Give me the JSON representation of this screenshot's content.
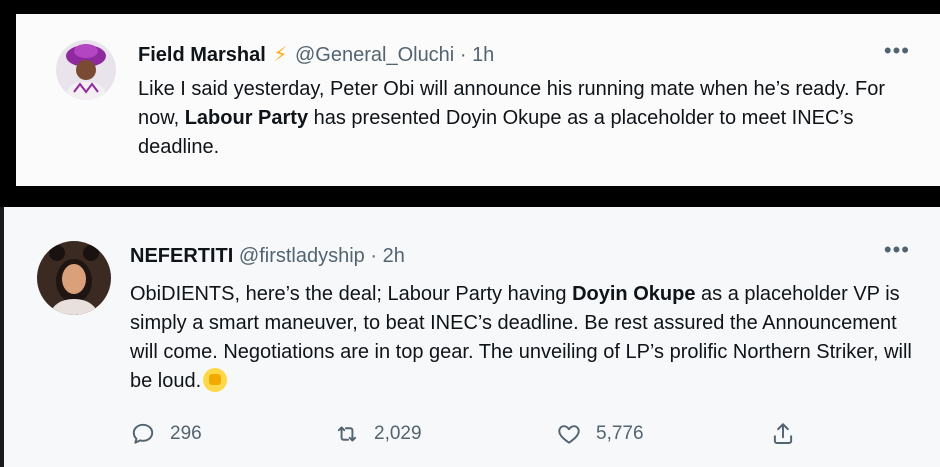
{
  "tweets": [
    {
      "display_name": "Field Marshal",
      "handle": "@General_Oluchi",
      "separator": "·",
      "time": "1h",
      "more_label": "•••",
      "text_parts": [
        {
          "t": "Like I said yesterday, Peter Obi will announce his running mate when he’s ready. For now, ",
          "bold": false
        },
        {
          "t": "Labour Party",
          "bold": true
        },
        {
          "t": " has presented Doyin Okupe as a placeholder to meet INEC’s deadline.",
          "bold": false
        }
      ]
    },
    {
      "display_name": "NEFERTITI",
      "handle": "@firstladyship",
      "separator": "·",
      "time": "2h",
      "more_label": "•••",
      "text_parts": [
        {
          "t": "ObiDIENTS, here’s the deal; Labour Party having ",
          "bold": false
        },
        {
          "t": "Doyin Okupe",
          "bold": true
        },
        {
          "t": " as a placeholder VP is simply a smart maneuver, to beat INEC’s deadline. Be rest assured the Announcement will come. Negotiations are in top gear. The unveiling of LP’s prolific Northern Striker, will be loud.",
          "bold": false
        }
      ],
      "actions": {
        "replies": "296",
        "retweets": "2,029",
        "likes": "5,776"
      }
    }
  ],
  "colors": {
    "text_primary": "#0f1419",
    "text_secondary": "#536471",
    "verified_bolt": "#ffad1f",
    "background_outer": "#000000"
  }
}
